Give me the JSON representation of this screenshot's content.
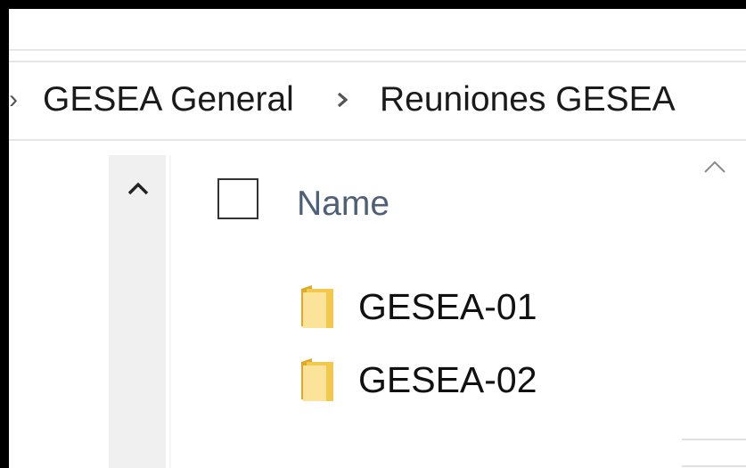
{
  "breadcrumb": {
    "items": [
      {
        "label": "GESEA General"
      },
      {
        "label": "Reuniones GESEA"
      }
    ]
  },
  "file_list": {
    "column_header": "Name",
    "sort_direction": "ascending",
    "items": [
      {
        "name": "GESEA-01",
        "type": "folder"
      },
      {
        "name": "GESEA-02",
        "type": "folder"
      }
    ]
  },
  "icons": {
    "folder": "folder-icon",
    "sort": "chevron-up-icon",
    "scroll_up": "chevron-up-icon",
    "breadcrumb_separator": "chevron-right-icon"
  },
  "colors": {
    "folder_fill": "#f2c94c",
    "folder_front": "#fbe39a",
    "header_text": "#4e5f78",
    "nav_pane": "#f0f0f0"
  }
}
